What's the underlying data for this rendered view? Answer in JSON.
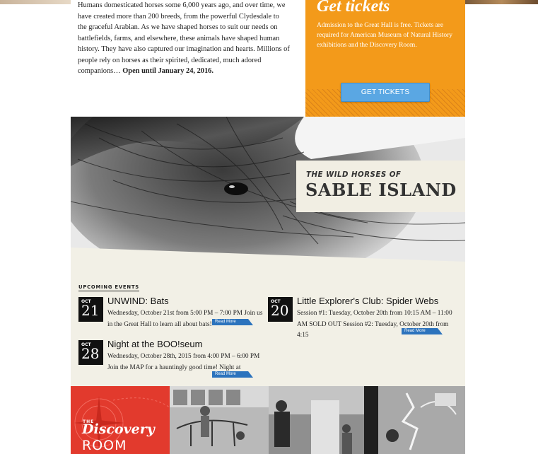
{
  "intro": {
    "text": "Humans domesticated horses some 6,000 years ago, and over time, we have created more than 200 breeds, from the powerful Clydesdale to the graceful Arabian. As we have shaped horses to suit our needs on battlefields, farms, and elsewhere, these animals have shaped human history. They have also captured our imagination and hearts. Millions of people rely on horses as their spirited, dedicated, much adored companions…",
    "open_until": "Open until January 24, 2016."
  },
  "tickets": {
    "title": "Get tickets",
    "description": "Admission to the Great Hall is free. Tickets are required for American Museum of Natural History exhibitions and the Discovery Room.",
    "button_label": "GET TICKETS"
  },
  "hero": {
    "subtitle": "THE WILD HORSES OF",
    "title": "SABLE ISLAND"
  },
  "events": {
    "heading": "UPCOMING EVENTS",
    "read_more_label": "Read More",
    "items": [
      {
        "month": "OCT",
        "day": "21",
        "title": "UNWIND: Bats",
        "description": "Wednesday, October 21st from 5:00 PM – 7:00 PM Join us in the Great Hall to learn all about bats!"
      },
      {
        "month": "OCT",
        "day": "20",
        "title": "Little Explorer's Club: Spider Webs",
        "description": "Session #1: Tuesday, October 20th from 10:15 AM – 11:00 AM SOLD OUT Session #2: Tuesday, October 20th from 4:15"
      },
      {
        "month": "OCT",
        "day": "28",
        "title": "Night at the BOO!seum",
        "description": "Wednesday, October 28th, 2015 from 4:00 PM – 6:00 PM Join the MAP for a hauntingly good time! Night at"
      }
    ]
  },
  "discovery": {
    "the": "THE",
    "name": "Discovery",
    "room": "ROOM"
  },
  "colors": {
    "tickets_orange": "#f39a1a",
    "button_blue": "#5aa7e3",
    "read_more_blue": "#2c73bd",
    "events_bg": "#f2f0e6",
    "discovery_red": "#e23a2d"
  }
}
